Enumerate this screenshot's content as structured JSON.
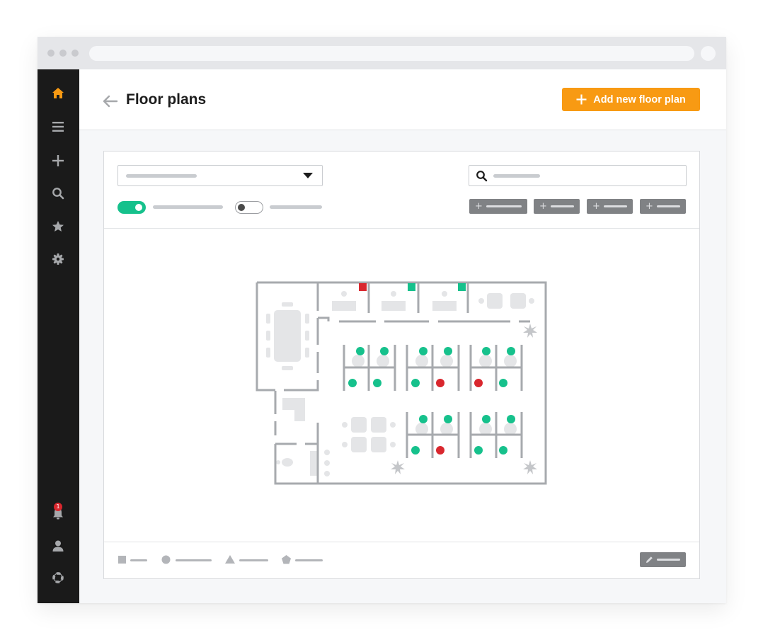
{
  "header": {
    "title": "Floor plans",
    "add_button_label": "Add new floor plan"
  },
  "sidebar": {
    "items": [
      {
        "icon": "home-icon",
        "active": true
      },
      {
        "icon": "menu-icon"
      },
      {
        "icon": "plus-icon"
      },
      {
        "icon": "search-icon"
      },
      {
        "icon": "star-icon"
      },
      {
        "icon": "gear-icon"
      }
    ],
    "bottom_items": [
      {
        "icon": "bell-icon",
        "badge": "1"
      },
      {
        "icon": "user-icon"
      },
      {
        "icon": "lifebuoy-icon"
      }
    ]
  },
  "toolbar": {
    "toggle_1_on": true,
    "toggle_2_on": false,
    "filter_buttons": 4
  },
  "floorplan": {
    "desk_status_colors": {
      "available": "#16c18c",
      "occupied": "#d9272e"
    },
    "room_status": [
      "occupied",
      "available",
      "available"
    ]
  },
  "colors": {
    "accent": "#f89a13",
    "sidebar_bg": "#1a1a1a",
    "toggle_on": "#16c18c",
    "available": "#16c18c",
    "occupied": "#d9272e"
  }
}
